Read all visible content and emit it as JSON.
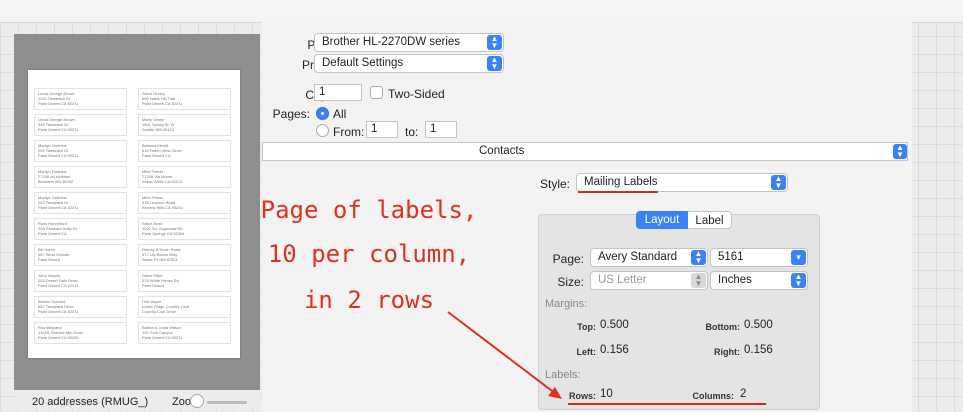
{
  "preview": {
    "labels": [
      [
        "Linda George Brown",
        "1142 Tamarack Dr",
        "Palm Desert CA 92211"
      ],
      [
        "Steve Hurley",
        "600 Hawk Hill Trail",
        "Palm Desert CA 92211"
      ],
      [
        "Linda George Brown",
        "346 Tamarack Dr",
        "Palm Desert CA 92211"
      ],
      [
        "Marty Crisler",
        "1801 Spring St. W",
        "Seattle WA 98124"
      ],
      [
        "Marilyn Dobbins",
        "292 Tamarack Dr",
        "Palm Desert CA 92211"
      ],
      [
        "Barbara Mendl",
        "618 Fallon View Circle",
        "Palm Desert CA"
      ],
      [
        "Marilyn Dobbins",
        "77206 Mt Hollister",
        "Brisbane WA 96202"
      ],
      [
        "Mike Peters",
        "77208 Via Monte",
        "Indian Wells CA 92210"
      ],
      [
        "Marilyn Dobbins",
        "292 Tamarack Dr",
        "Palm Desert CA 92211"
      ],
      [
        "Mike Peters",
        "976 Leopard Road",
        "Beverly Hills CA 90210"
      ],
      [
        "Ross Hanneford",
        "408 Seaward Holly Dr",
        "Palm Desert CA"
      ],
      [
        "Steve Ruse",
        "1002 So. Sugarloaf Rd",
        "Palm Springs CA 92264"
      ],
      [
        "Bill Harris",
        "467 West Grande",
        "Palm Desert"
      ],
      [
        "Ramey & Kevin Rowe",
        "477 Lily Bloom Way",
        "Santa Fe NM 87501"
      ],
      [
        "Jerry Wayne",
        "203 Desert Falls Drive",
        "Palm Desert CA 92211"
      ],
      [
        "Steve Ritter",
        "325 White House Rd",
        "Palm Desert"
      ],
      [
        "Bennie Howard",
        "687 Tamarack Drive",
        "Palm Desert CA 92211"
      ],
      [
        "Holt Mayer",
        "Indian Ridge Country Club",
        "Country Club Drive"
      ],
      [
        "Roy Weyland",
        "13018 Shadow Mtn Drive",
        "Palm Desert CA 92260"
      ],
      [
        "Bubba & Linda Wilson",
        "110 Gold Canyon",
        "Palm Desert CA 92211"
      ]
    ]
  },
  "status": {
    "count": "20 addresses (RMUG_)",
    "zoom_label": "Zoom:",
    "zoom_level": 0.0
  },
  "print": {
    "printer_label": "Printer:",
    "printer_value": "Brother HL-2270DW series",
    "presets_label": "Presets:",
    "presets_value": "Default Settings",
    "copies_label": "Copies:",
    "copies_value": "1",
    "two_sided_label": "Two-Sided",
    "pages_label": "Pages:",
    "pages_all": "All",
    "pages_from_label": "From:",
    "pages_from_value": "1",
    "pages_to_label": "to:",
    "pages_to_value": "1",
    "app_section": "Contacts"
  },
  "contacts": {
    "style_label": "Style:",
    "style_value": "Mailing Labels",
    "tab_layout": "Layout",
    "tab_label": "Label",
    "page_label": "Page:",
    "page_value": "Avery Standard",
    "page_code": "5161",
    "size_label": "Size:",
    "size_value": "US Letter",
    "units_value": "Inches",
    "margins_title": "Margins:",
    "top_label": "Top:",
    "top_value": "0.500",
    "bottom_label": "Bottom:",
    "bottom_value": "0.500",
    "left_label": "Left:",
    "left_value": "0.156",
    "right_label": "Right:",
    "right_value": "0.156",
    "labels_title": "Labels:",
    "rows_label": "Rows:",
    "rows_value": "10",
    "columns_label": "Columns:",
    "columns_value": "2"
  },
  "annotation": {
    "line1": "Page of labels,",
    "line2": "10 per column,",
    "line3": "in 2 rows"
  },
  "colors": {
    "accent": "#3b82f6",
    "annotation": "#e0301e"
  }
}
